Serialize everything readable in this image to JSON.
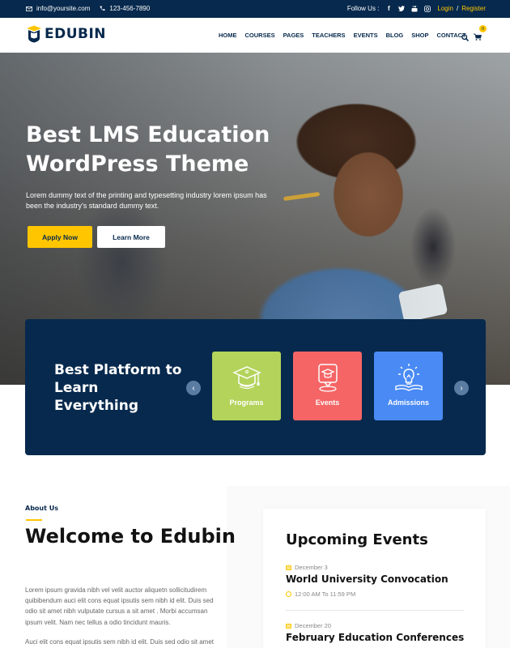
{
  "topbar": {
    "email": "info@yoursite.com",
    "phone": "123-456-7890",
    "follow_label": "Follow Us :",
    "social": [
      {
        "icon": "facebook-icon",
        "glyph": "f"
      },
      {
        "icon": "twitter-icon",
        "glyph": "t"
      },
      {
        "icon": "youtube-icon",
        "glyph": "y"
      },
      {
        "icon": "instagram-icon",
        "glyph": "◎"
      }
    ],
    "login": "Login",
    "separator": "/",
    "register": "Register"
  },
  "header": {
    "logo_text": "EDUBIN",
    "nav": [
      "HOME",
      "COURSES",
      "PAGES",
      "TEACHERS",
      "EVENTS",
      "BLOG",
      "SHOP",
      "CONTACT"
    ],
    "cart_count": "0"
  },
  "hero": {
    "title": "Best LMS Education WordPress Theme",
    "subtitle": "Lorem dummy text of the printing and typesetting industry lorem ipsum has been the industry's standard dummy text.",
    "apply_label": "Apply Now",
    "learn_label": "Learn More"
  },
  "platform": {
    "title": "Best Platform to Learn Everything",
    "prev": "‹",
    "next": "›",
    "cards": [
      {
        "label": "Programs",
        "icon": "graduation-cap-icon",
        "color": "#b3d35b"
      },
      {
        "label": "Events",
        "icon": "location-cap-icon",
        "color": "#f56565"
      },
      {
        "label": "Admissions",
        "icon": "lightbulb-book-icon",
        "color": "#4a8af4"
      }
    ]
  },
  "about": {
    "kicker": "About Us",
    "title": "Welcome to Edubin",
    "paragraph1": "Lorem ipsum gravida nibh vel velit auctor aliquetn sollicitudirem quibibendum auci elit cons equat ipsutis sem nibh id elit. Duis sed odio sit amet nibh vulputate cursus a sit amet . Morbi accumsan ipsum velit. Nam nec tellus a odio tincidunt mauris.",
    "paragraph2": "Auci elit cons equat ipsutis sem nibh id elit. Duis sed odio sit amet"
  },
  "events": {
    "title": "Upcoming Events",
    "items": [
      {
        "date": "December 3",
        "title": "World University Convocation",
        "time": "12:00 AM To 11:59 PM"
      },
      {
        "date": "December 20",
        "title": "February Education Conferences"
      }
    ]
  },
  "colors": {
    "navy": "#07294d",
    "accent": "#ffc600"
  }
}
